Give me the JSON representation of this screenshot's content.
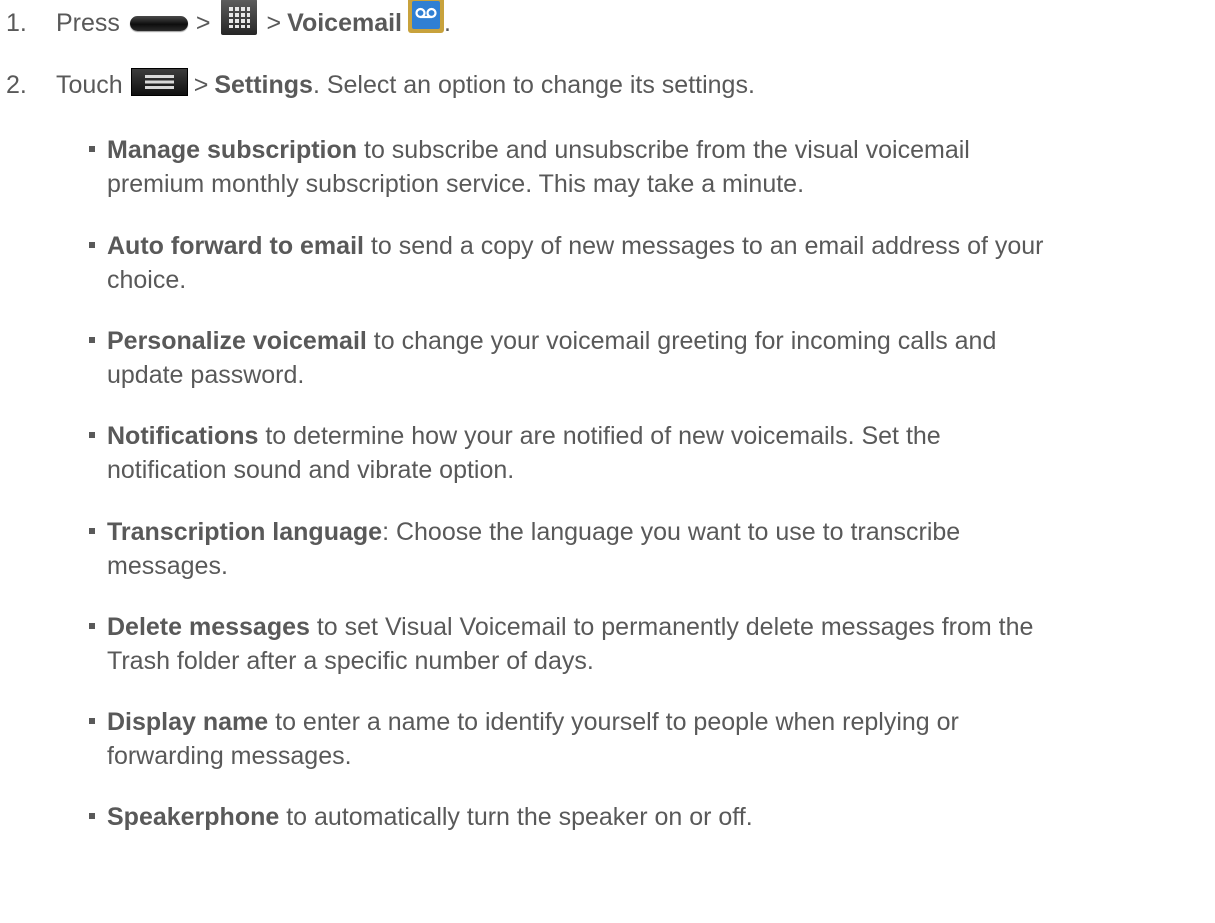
{
  "steps": [
    {
      "number": "1.",
      "press": "Press",
      "sep1": ">",
      "sep2": ">",
      "target": "Voicemail",
      "end": ".",
      "icons": [
        "home-key-icon",
        "apps-icon",
        "voicemail-app-icon"
      ]
    },
    {
      "number": "2.",
      "touch": "Touch",
      "sep": ">",
      "target": "Settings",
      "rest": ". Select an option to change its settings.",
      "icons": [
        "menu-key-icon"
      ]
    }
  ],
  "options": [
    {
      "title": "Manage subscription",
      "line1": " to subscribe and unsubscribe from the visual voicemail",
      "line2": "premium monthly subscription service. This may take a minute."
    },
    {
      "title": "Auto forward to email",
      "line1": " to send a copy of new messages to an email address of your",
      "line2": "choice."
    },
    {
      "title": "Personalize voicemail",
      "line1": " to change your voicemail greeting for incoming calls and",
      "line2": "update password."
    },
    {
      "title": "Notifications",
      "line1": " to determine how your are notified of new voicemails. Set the",
      "line2": "notification sound and vibrate option."
    },
    {
      "title": "Transcription language",
      "line1": ": Choose the language you want to use to transcribe",
      "line2": "messages."
    },
    {
      "title": "Delete messages",
      "line1": " to set Visual Voicemail to permanently delete messages from the",
      "line2": "Trash folder after a specific number of days."
    },
    {
      "title": "Display name",
      "line1": " to enter a name to identify yourself to people when replying or",
      "line2": "forwarding messages."
    },
    {
      "title": "Speakerphone",
      "line1": " to automatically turn the speaker on or off.",
      "line2": ""
    }
  ],
  "colors": {
    "text": "#595959",
    "voicemail_icon_bg": "#c8a23c",
    "voicemail_icon_fg": "#2f7fd3"
  }
}
